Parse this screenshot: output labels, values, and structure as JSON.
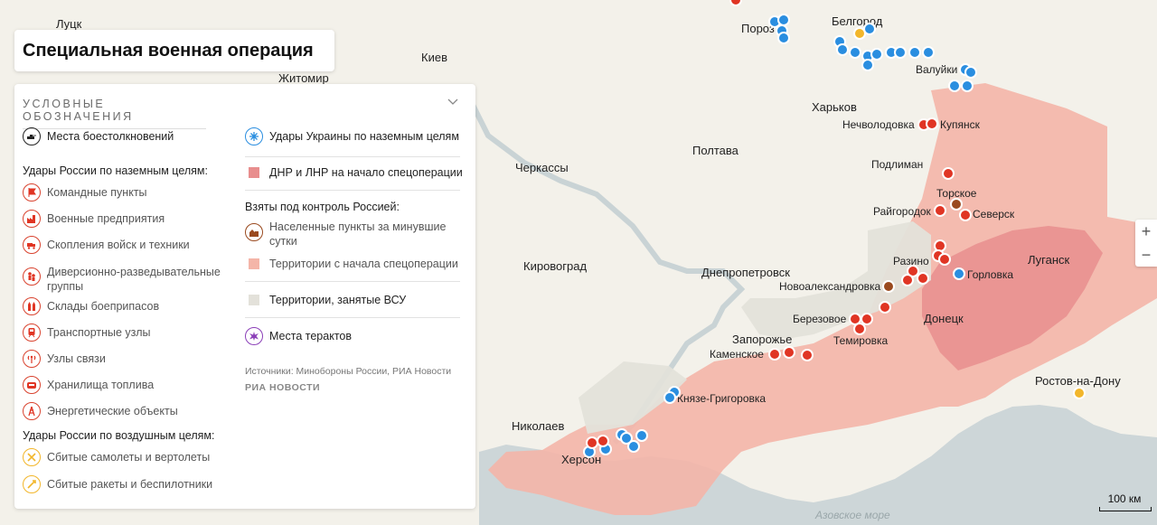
{
  "title": "Специальная военная операция",
  "legend": {
    "heading": "УСЛОВНЫЕ ОБОЗНАЧЕНИЯ",
    "battles": "Места боестолкновений",
    "ru_ground_heading": "Удары России по наземным целям:",
    "ru_ground": [
      "Командные пункты",
      "Военные предприятия",
      "Скопления войск и техники",
      "Диверсионно-разведывательные группы",
      "Склады боеприпасов",
      "Транспортные узлы",
      "Узлы связи",
      "Хранилища топлива",
      "Энергетические объекты"
    ],
    "ru_air_heading": "Удары России по воздушным целям:",
    "ru_air": [
      "Сбитые самолеты и вертолеты",
      "Сбитые ракеты и беспилотники"
    ],
    "ua_strikes": "Удары Украины по наземным целям",
    "dnr_lnr": "ДНР и ЛНР на начало спецоперации",
    "taken_heading": "Взяты под контроль Россией:",
    "taken_day": "Населенные пункты за минувшие сутки",
    "taken_since": "Территории с начала спецоперации",
    "afu_held": "Территории, занятые ВСУ",
    "terror": "Места терактов",
    "sources": "Источники: Минобороны России, РИА Новости",
    "ria": "РИА НОВОСТИ"
  },
  "colors": {
    "ru_strike": "#e03524",
    "ua_strike": "#2a8ee0",
    "taken_day": "#9a4a1f",
    "air": "#f2b62b",
    "dnr": "#e88e8e",
    "taken": "#f4b5a8",
    "afu": "#e3e1da",
    "terror": "#8b3fb8"
  },
  "map": {
    "cities": [
      "Луцк",
      "Житомир",
      "Киев",
      "Белгород",
      "Пороз",
      "Харьков",
      "Валуйки",
      "Нечволодовка",
      "Купянск",
      "Полтава",
      "Черкассы",
      "Подлиман",
      "Торское",
      "Райгородок",
      "Северск",
      "Луганск",
      "Разино",
      "Горловка",
      "Кировоград",
      "Днепропетровск",
      "Новоалександровка",
      "Донецк",
      "Березовое",
      "Запорожье",
      "Темировка",
      "Каменское",
      "Князе-Григоровка",
      "Ростов-на-Дону",
      "Николаев",
      "Херсон",
      "Азовское море"
    ],
    "scale": "100 км"
  }
}
